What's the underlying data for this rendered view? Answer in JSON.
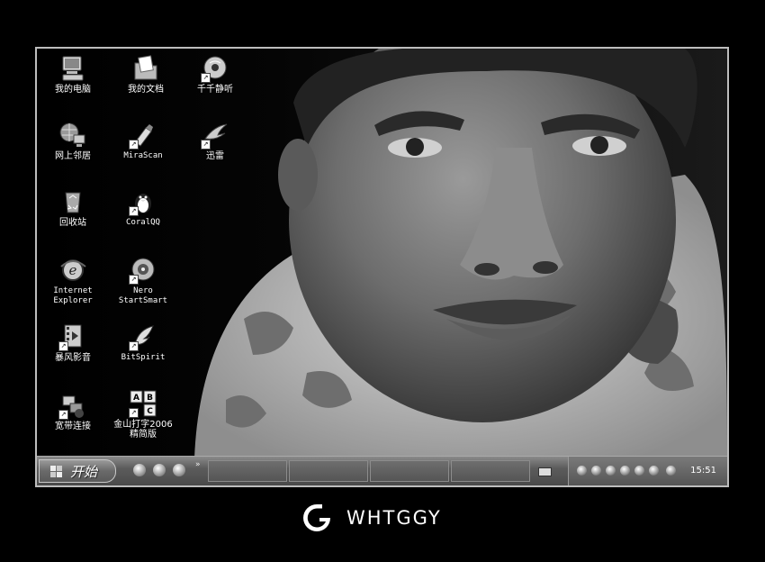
{
  "desktop": {
    "icons": [
      {
        "label": "我的电脑",
        "icon": "computer-icon"
      },
      {
        "label": "我的文档",
        "icon": "documents-icon"
      },
      {
        "label": "千千静听",
        "icon": "music-player-icon"
      },
      {
        "label": "网上邻居",
        "icon": "network-icon"
      },
      {
        "label": "MiraScan",
        "icon": "scanner-icon"
      },
      {
        "label": "迅雷",
        "icon": "thunder-icon"
      },
      {
        "label": "回收站",
        "icon": "recycle-bin-icon"
      },
      {
        "label": "CoralQQ",
        "icon": "penguin-icon"
      },
      {
        "label": "Internet\nExplorer",
        "icon": "ie-icon"
      },
      {
        "label": "Nero\nStartSmart",
        "icon": "disc-icon"
      },
      {
        "label": "暴风影音",
        "icon": "video-player-icon"
      },
      {
        "label": "BitSpirit",
        "icon": "bitspirit-icon"
      },
      {
        "label": "宽带连接",
        "icon": "broadband-icon"
      },
      {
        "label": "金山打字2006\n精简版",
        "icon": "typing-abc-icon"
      }
    ]
  },
  "taskbar": {
    "start_label": "开始",
    "clock": "15:51",
    "quicklaunch": [
      "show-desktop-icon",
      "media-icon",
      "ie-icon"
    ],
    "tray": [
      "qq-icon",
      "penguin-icon",
      "shield-icon",
      "user-icon",
      "network-icon",
      "speaker-icon",
      "antivirus-icon"
    ]
  },
  "watermark": {
    "text": "WHTGGY"
  }
}
